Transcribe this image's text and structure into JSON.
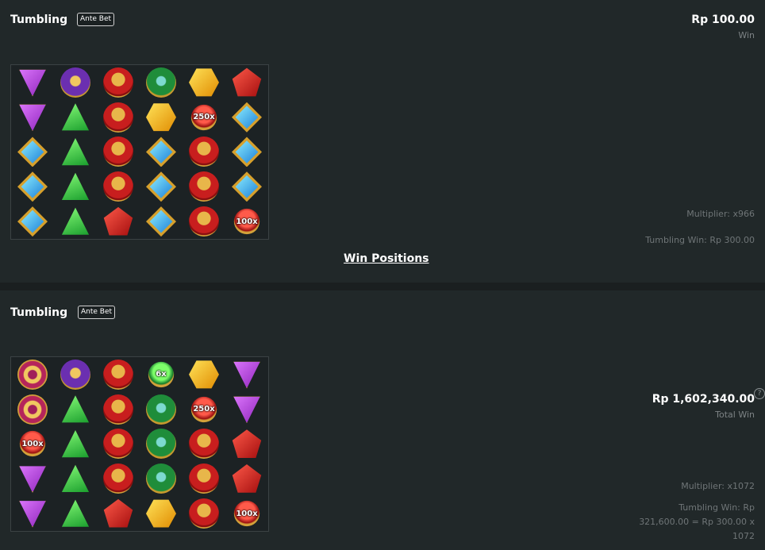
{
  "rounds": [
    {
      "title": "Tumbling",
      "badge": "Ante Bet",
      "amount": "Rp 100.00",
      "amount_label": "Win",
      "multiplier": "Multiplier: x966",
      "tumbling_win": "Tumbling Win: Rp 300.00",
      "link": "Win Positions",
      "grid": [
        [
          "purple-gem",
          "hourglass",
          "crown",
          "chalice",
          "yellow-gem",
          "red-gem"
        ],
        [
          "purple-gem",
          "green-gem",
          "crown",
          "yellow-gem",
          "multiplier-red",
          "blue-gem"
        ],
        [
          "blue-gem",
          "green-gem",
          "crown",
          "blue-gem",
          "crown",
          "blue-gem"
        ],
        [
          "blue-gem",
          "green-gem",
          "crown",
          "blue-gem",
          "crown",
          "blue-gem"
        ],
        [
          "blue-gem",
          "green-gem",
          "red-gem",
          "blue-gem",
          "crown",
          "multiplier-red"
        ]
      ],
      "multiplier_labels": {
        "1-4": "250x",
        "4-5": "100x"
      }
    },
    {
      "title": "Tumbling",
      "badge": "Ante Bet",
      "amount": "Rp 1,602,340.00",
      "amount_label": "Total Win",
      "help": "?",
      "multiplier": "Multiplier: x1072",
      "tumbling_win": "Tumbling Win: Rp 321,600.00 = Rp 300.00 x 1072",
      "grid": [
        [
          "ring",
          "hourglass",
          "crown",
          "multiplier-green",
          "yellow-gem",
          "purple-gem"
        ],
        [
          "ring",
          "green-gem",
          "crown",
          "chalice",
          "multiplier-red",
          "purple-gem"
        ],
        [
          "multiplier-red",
          "green-gem",
          "crown",
          "chalice",
          "crown",
          "red-gem"
        ],
        [
          "purple-gem",
          "green-gem",
          "crown",
          "chalice",
          "crown",
          "red-gem"
        ],
        [
          "purple-gem",
          "green-gem",
          "red-gem",
          "yellow-gem",
          "crown",
          "multiplier-red"
        ]
      ],
      "multiplier_labels": {
        "0-3": "6x",
        "1-4": "250x",
        "2-0": "100x",
        "4-5": "100x"
      }
    }
  ]
}
